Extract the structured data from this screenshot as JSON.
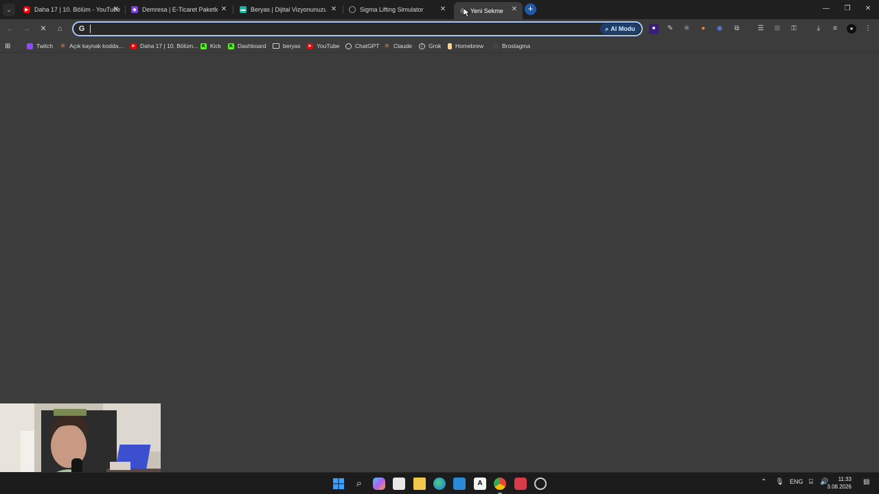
{
  "tabs": [
    {
      "title": "Daha 17 | 10. Bölüm - YouTube",
      "favicon": "youtube-icon",
      "color": "#ff0000"
    },
    {
      "title": "Demresa | E-Ticaret Paketleri &",
      "favicon": "demresa-icon",
      "color": "#7b3fe4"
    },
    {
      "title": "Beryas | Dijital Vizyonunuzu Ge",
      "favicon": "beryas-icon",
      "color": "#17b3a3"
    },
    {
      "title": "Sigma Lifting Simulator",
      "favicon": "globe-icon",
      "color": "#9aa0a6"
    },
    {
      "title": "Yeni Sekme",
      "favicon": "chrome-icon",
      "color": "#cccccc",
      "active": true
    }
  ],
  "omnibox": {
    "value": "",
    "ai_mode_label": "AI Modu"
  },
  "bookmarks": [
    {
      "label": "Twitch",
      "icon": "twitch-icon",
      "color": "#9146ff"
    },
    {
      "label": "Açık kaynak kodda...",
      "icon": "claude-icon",
      "color": "#d97757"
    },
    {
      "label": "Daha 17 | 10. Bölüm...",
      "icon": "youtube-icon",
      "color": "#ff0000"
    },
    {
      "label": "Kick",
      "icon": "kick-icon",
      "color": "#53fc18"
    },
    {
      "label": "Dashboard",
      "icon": "kick-icon",
      "color": "#53fc18"
    },
    {
      "label": "beryas",
      "icon": "folder-icon",
      "color": "#dcdcdc"
    },
    {
      "label": "YouTube",
      "icon": "youtube-icon",
      "color": "#ff0000"
    },
    {
      "label": "ChatGPT",
      "icon": "chatgpt-icon",
      "color": "#dcdcdc"
    },
    {
      "label": "Claude",
      "icon": "claude-icon",
      "color": "#d97757"
    },
    {
      "label": "Grok",
      "icon": "grok-icon",
      "color": "#dcdcdc"
    },
    {
      "label": "Homebrew",
      "icon": "homebrew-icon",
      "color": "#f9d094"
    },
    {
      "label": "Brostagma",
      "icon": "github-icon",
      "color": "#555555"
    }
  ],
  "taskbar": {
    "language": "ENG",
    "time": "11:33",
    "date": "3.08.2026"
  },
  "colors": {
    "chrome_dark": "#1f1f1f",
    "chrome_toolbar": "#3c3c3c",
    "focus_ring": "#a8c7fa",
    "new_tab_button": "#1e5aa8"
  }
}
